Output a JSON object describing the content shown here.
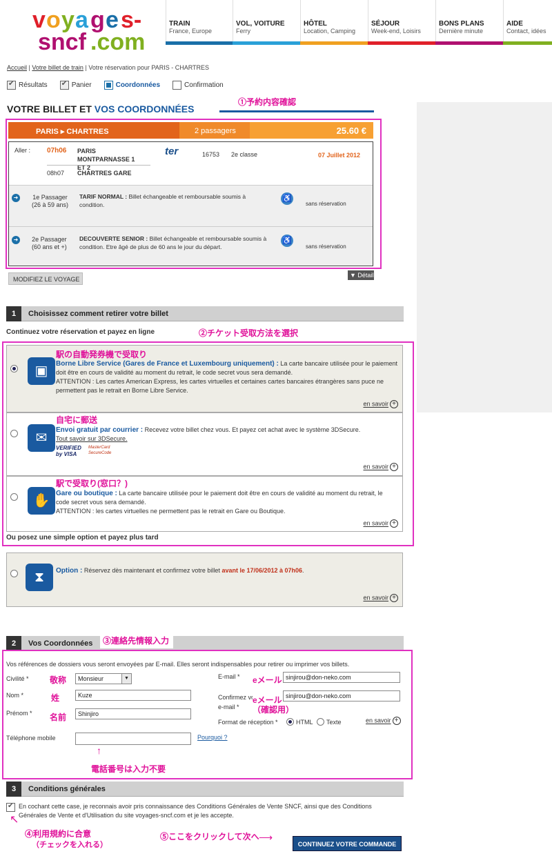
{
  "header": {
    "logo": "voyages-sncf.com",
    "nav": [
      {
        "title": "TRAIN",
        "sub": "France, Europe",
        "color": "#1a6fa8"
      },
      {
        "title": "VOL, VOITURE",
        "sub": "Ferry",
        "color": "#2aa0d8"
      },
      {
        "title": "HÔTEL",
        "sub": "Location, Camping",
        "color": "#f0a020"
      },
      {
        "title": "SÉJOUR",
        "sub": "Week-end, Loisirs",
        "color": "#e0202a"
      },
      {
        "title": "BONS PLANS",
        "sub": "Dernière minute",
        "color": "#b01070"
      },
      {
        "title": "AIDE",
        "sub": "Contact, idées",
        "color": "#80b020"
      }
    ]
  },
  "breadcrumb": {
    "home": "Accueil",
    "sep": "|",
    "ticket": "Votre billet de train",
    "current": "Votre réservation pour PARIS - CHARTRES"
  },
  "steps": [
    "Résultats",
    "Panier",
    "Coordonnées",
    "Confirmation"
  ],
  "title": {
    "part1": "VOTRE BILLET ET ",
    "part2": "VOS COORDONNÉES"
  },
  "notes": {
    "n1": "①予約内容確認",
    "n2": "②チケット受取方法を選択",
    "n3": "③連絡先情報入力",
    "n4a": "④利用規約に合意",
    "n4b": "（チェックを入れる）",
    "n5": "⑤ここをクリックして次へ",
    "opt1": "駅の自動発券機で受取り",
    "opt2": "自宅に郵送",
    "opt3": "駅で受取り(窓口？)",
    "civ": "敬称",
    "nom": "姓",
    "prenom": "名前",
    "email": "eメール",
    "email2": "eメール",
    "email2b": "（確認用）",
    "tel": "電話番号は入力不要"
  },
  "trip": {
    "route": "PARIS ▸ CHARTRES",
    "passengers": "2 passagers",
    "price": "25.60 €",
    "aller": "Aller :",
    "dep_time": "07h06",
    "dep_station": "PARIS MONTPARNASSE 1 ET 2",
    "train_no": "16753",
    "class": "2e classe",
    "date": "07 Juillet 2012",
    "arr_time": "08h07",
    "arr_station": "CHARTRES GARE",
    "ter": "ter",
    "pax": [
      {
        "label": "1e Passager",
        "age": "(26 à 59 ans)",
        "tarif": "TARIF NORMAL :",
        "desc": "Billet échangeable et remboursable soumis à condition.",
        "res": "sans réservation"
      },
      {
        "label": "2e Passager",
        "age": "(60 ans et +)",
        "tarif": "DECOUVERTE SENIOR :",
        "desc": "Billet échangeable et remboursable soumis à condition. Etre âgé de plus de 60 ans le jour du départ.",
        "res": "sans réservation"
      }
    ]
  },
  "buttons": {
    "modify": "MODIFIEZ LE VOYAGE",
    "detail": "▼ Détail",
    "continue": "CONTINUEZ VOTRE COMMANDE"
  },
  "section1": {
    "num": "1",
    "title": "Choisissez comment retirer votre billet",
    "subtitle": "Continuez votre réservation et payez en ligne",
    "subtitle2": "Ou posez une simple option et payez plus tard",
    "en_savoir": "en savoir",
    "options": [
      {
        "title": "Borne Libre Service (Gares de France et Luxembourg uniquement) :",
        "text": "La carte bancaire utilisée pour le paiement doit être en cours de validité au moment du retrait, le code secret vous sera demandé.",
        "text2": "ATTENTION : Les cartes American Express, les cartes virtuelles et certaines cartes bancaires étrangères sans puce ne permettent pas le retrait en Borne Libre Service."
      },
      {
        "title": "Envoi gratuit par courrier :",
        "text": "Recevez votre billet chez vous. Et payez cet achat avec le système 3DSecure.",
        "link": "Tout savoir sur 3DSecure.",
        "visa": "VERIFIED by VISA",
        "mc": "MasterCard SecureCode"
      },
      {
        "title": "Gare ou boutique :",
        "text": "La carte bancaire utilisée pour le paiement doit être en cours de validité au moment du retrait, le code secret vous sera demandé.",
        "text2": "ATTENTION : les cartes virtuelles ne permettent pas le retrait en Gare ou Boutique."
      },
      {
        "title": "Option :",
        "text": "Réservez dès maintenant et confirmez votre billet",
        "deadline": "avant le 17/06/2012 à 07h06",
        "end": "."
      }
    ]
  },
  "section2": {
    "num": "2",
    "title": "Vos Coordonnées",
    "intro": "Vos références de dossiers vous seront envoyées par E-mail. Elles seront indispensables pour retirer ou imprimer vos billets.",
    "civ_label": "Civilité *",
    "civ_value": "Monsieur",
    "nom_label": "Nom *",
    "nom_value": "Kuze",
    "prenom_label": "Prénom *",
    "prenom_value": "Shinjiro",
    "tel_label": "Téléphone mobile",
    "tel_value": "",
    "pourquoi": "Pourquoi ?",
    "email_label": "E-mail *",
    "email_value": "sinjirou@don-neko.com",
    "email2_label": "Confirmez votre e-mail *",
    "email2_value": "sinjirou@don-neko.com",
    "format_label": "Format de réception *",
    "html": "HTML",
    "texte": "Texte",
    "en_savoir": "en savoir"
  },
  "section3": {
    "num": "3",
    "title": "Conditions générales",
    "text": "En cochant cette case, je reconnais avoir pris connaissance des Conditions Générales de Vente SNCF, ainsi que des Conditions Générales de Vente et d'Utilisation du site voyages-sncf.com et je les accepte."
  }
}
